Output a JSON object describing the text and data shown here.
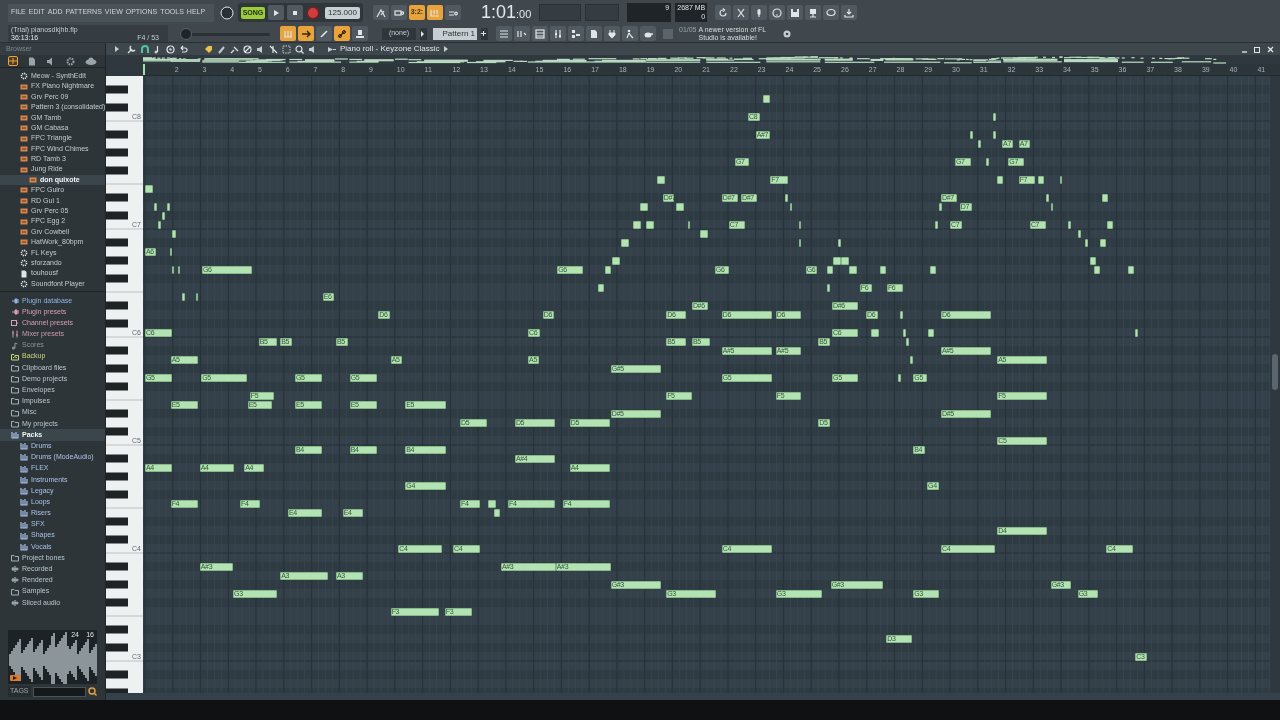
{
  "menu": [
    "FILE",
    "EDIT",
    "ADD",
    "PATTERNS",
    "VIEW",
    "OPTIONS",
    "TOOLS",
    "HELP"
  ],
  "hint_panel": {
    "title": "(Trial) pianosdkjhb.flp",
    "time": "36:13:16",
    "position": "F4 / 53"
  },
  "transport": {
    "mode": "SONG",
    "song_mode": true,
    "tempo": "125.000"
  },
  "toggles_top": [
    {
      "on": false
    },
    {
      "on": false
    },
    {
      "on": true,
      "label": "3:2:"
    },
    {
      "on": true
    },
    {
      "on": false
    }
  ],
  "toggles_bottom": [
    {
      "on": true
    },
    {
      "on": true
    },
    {
      "on": false
    },
    {
      "on": true
    },
    {
      "on": false
    }
  ],
  "pitch_slider": {
    "level": 0
  },
  "clock": {
    "main": "1:01",
    "ticks": ":00"
  },
  "monitor": {
    "cpu": "9",
    "memory": "2687 MB",
    "polyphony": "0"
  },
  "pattern": {
    "target": "(none)",
    "name": "Pattern 1"
  },
  "news": {
    "counter": "01/05",
    "text": "A newer version of FL Studio is available!"
  },
  "browser": {
    "title": "Browser",
    "channels": [
      {
        "label": "Meow - SynthEdit",
        "kind": "gear",
        "selected": false
      },
      {
        "label": "FX Piano Nightmare",
        "kind": "pattern",
        "selected": false
      },
      {
        "label": "Grv Perc 09",
        "kind": "pattern",
        "selected": false
      },
      {
        "label": "Pattern 3 (consolidated)",
        "kind": "pattern",
        "selected": false
      },
      {
        "label": "GM Tamb",
        "kind": "pattern",
        "selected": false
      },
      {
        "label": "GM Cabasa",
        "kind": "pattern",
        "selected": false
      },
      {
        "label": "FPC Triangle",
        "kind": "pattern",
        "selected": false
      },
      {
        "label": "FPC Wind Chimes",
        "kind": "pattern",
        "selected": false
      },
      {
        "label": "RD Tamb 3",
        "kind": "pattern",
        "selected": false
      },
      {
        "label": "Jung Ride",
        "kind": "pattern",
        "selected": false,
        "children": [
          {
            "label": "don quixote",
            "kind": "pattern",
            "selected": true
          }
        ]
      },
      {
        "label": "FPC Guiro",
        "kind": "pattern",
        "selected": false
      },
      {
        "label": "RD Gui 1",
        "kind": "pattern",
        "selected": false
      },
      {
        "label": "Grv Perc 05",
        "kind": "pattern",
        "selected": false
      },
      {
        "label": "FPC Egg 2",
        "kind": "pattern",
        "selected": false
      },
      {
        "label": "Grv Cowbell",
        "kind": "pattern",
        "selected": false
      },
      {
        "label": "HatWork_80bpm",
        "kind": "pattern",
        "selected": false
      },
      {
        "label": "FL Keys",
        "kind": "gear",
        "selected": false
      },
      {
        "label": "sforzando",
        "kind": "gear",
        "selected": false
      },
      {
        "label": "touhousf",
        "kind": "file",
        "selected": false
      },
      {
        "label": "Soundfont Player",
        "kind": "gear",
        "selected": false
      }
    ],
    "folders": [
      {
        "label": "Plugin database",
        "kind": "database",
        "selected": false
      },
      {
        "label": "Plugin presets",
        "kind": "preset",
        "selected": false
      },
      {
        "label": "Channel presets",
        "kind": "channel_preset",
        "selected": false
      },
      {
        "label": "Mixer presets",
        "kind": "mixer_preset",
        "selected": false
      },
      {
        "label": "Scores",
        "kind": "score",
        "selected": false
      },
      {
        "label": "Backup",
        "kind": "backup",
        "selected": false
      },
      {
        "label": "Clipboard files",
        "kind": "folder",
        "selected": false
      },
      {
        "label": "Demo projects",
        "kind": "folder",
        "selected": false
      },
      {
        "label": "Envelopes",
        "kind": "folder",
        "selected": false
      },
      {
        "label": "Impulses",
        "kind": "folder",
        "selected": false
      },
      {
        "label": "Misc",
        "kind": "folder",
        "selected": false
      },
      {
        "label": "My projects",
        "kind": "folder",
        "selected": false
      },
      {
        "label": "Packs",
        "kind": "pack",
        "selected": true,
        "children": [
          {
            "label": "Drums",
            "kind": "pack",
            "selected": false
          },
          {
            "label": "Drums (ModeAudio)",
            "kind": "pack",
            "selected": false
          },
          {
            "label": "FLEX",
            "kind": "pack",
            "selected": false
          },
          {
            "label": "Instruments",
            "kind": "pack",
            "selected": false
          },
          {
            "label": "Legacy",
            "kind": "pack",
            "selected": false
          },
          {
            "label": "Loops",
            "kind": "pack",
            "selected": false
          },
          {
            "label": "Risers",
            "kind": "pack",
            "selected": false
          },
          {
            "label": "SFX",
            "kind": "pack",
            "selected": false
          },
          {
            "label": "Shapes",
            "kind": "pack",
            "selected": false
          },
          {
            "label": "Vocals",
            "kind": "pack",
            "selected": false
          }
        ]
      },
      {
        "label": "Project bones",
        "kind": "folder",
        "selected": false
      },
      {
        "label": "Recorded",
        "kind": "recorded",
        "selected": false
      },
      {
        "label": "Rendered",
        "kind": "recorded",
        "selected": false
      },
      {
        "label": "Samples",
        "kind": "folder",
        "selected": false
      },
      {
        "label": "Sliced audio",
        "kind": "recorded",
        "selected": false
      }
    ],
    "preview": {
      "bits": "24",
      "channels": "16"
    },
    "tags_label": "TAGS"
  },
  "piano_roll": {
    "title": "Piano roll - Keyzone Classic",
    "bars": [
      "2",
      "3",
      "4",
      "5",
      "6",
      "7",
      "8",
      "9",
      "10",
      "11",
      "12",
      "13",
      "14",
      "15",
      "16",
      "17",
      "18",
      "19",
      "20",
      "21",
      "22",
      "23",
      "24",
      "25",
      "26",
      "27",
      "28",
      "29",
      "30",
      "31",
      "32",
      "33",
      "34",
      "35",
      "36",
      "37",
      "38",
      "39",
      "40",
      "41"
    ],
    "octaves": [
      "C8",
      "C7",
      "C6",
      "C5",
      "C4",
      "C3"
    ],
    "notes": [
      {
        "kind": "short"
      },
      {
        "kind": "short"
      },
      {
        "kind": "short"
      },
      {
        "kind": "short"
      },
      {
        "kind": "short"
      },
      {
        "kind": "short"
      },
      {
        "kind": "labeled",
        "label": "A6"
      },
      {
        "kind": "short"
      },
      {
        "kind": "short"
      },
      {
        "kind": "short"
      },
      {
        "kind": "labeled",
        "label": "G6"
      },
      {
        "kind": "short"
      },
      {
        "kind": "short"
      },
      {
        "kind": "labeled",
        "label": "E6"
      },
      {
        "kind": "labeled",
        "label": "D6"
      },
      {
        "kind": "labeled",
        "label": "C6"
      },
      {
        "kind": "labeled",
        "label": "B5"
      },
      {
        "kind": "labeled",
        "label": "B5"
      },
      {
        "kind": "labeled",
        "label": "B5"
      },
      {
        "kind": "labeled",
        "label": "A5"
      },
      {
        "kind": "labeled",
        "label": "A5"
      },
      {
        "kind": "labeled",
        "label": "G5"
      },
      {
        "kind": "labeled",
        "label": "G5"
      },
      {
        "kind": "labeled",
        "label": "G5"
      },
      {
        "kind": "labeled",
        "label": "G5"
      },
      {
        "kind": "labeled",
        "label": "F5"
      },
      {
        "kind": "labeled",
        "label": "E5"
      },
      {
        "kind": "labeled",
        "label": "E5"
      },
      {
        "kind": "labeled",
        "label": "E5"
      },
      {
        "kind": "labeled",
        "label": "E5"
      },
      {
        "kind": "labeled",
        "label": "E5"
      },
      {
        "kind": "labeled",
        "label": "B4"
      },
      {
        "kind": "labeled",
        "label": "B4"
      },
      {
        "kind": "labeled",
        "label": "B4"
      },
      {
        "kind": "labeled",
        "label": "A4"
      },
      {
        "kind": "labeled",
        "label": "A4"
      },
      {
        "kind": "labeled",
        "label": "A4"
      },
      {
        "kind": "labeled",
        "label": "D5"
      },
      {
        "kind": "labeled",
        "label": "D5"
      },
      {
        "kind": "labeled",
        "label": "D5"
      },
      {
        "kind": "labeled",
        "label": "G4"
      },
      {
        "kind": "labeled",
        "label": "F4"
      },
      {
        "kind": "labeled",
        "label": "F4"
      },
      {
        "kind": "labeled",
        "label": "F4"
      },
      {
        "kind": "short"
      },
      {
        "kind": "labeled",
        "label": "F4"
      },
      {
        "kind": "labeled",
        "label": "F4"
      },
      {
        "kind": "labeled",
        "label": "E4"
      },
      {
        "kind": "labeled",
        "label": "E4"
      },
      {
        "kind": "short"
      },
      {
        "kind": "labeled",
        "label": "C4"
      },
      {
        "kind": "labeled",
        "label": "C4"
      },
      {
        "kind": "labeled",
        "label": "A#3"
      },
      {
        "kind": "labeled",
        "label": "A3"
      },
      {
        "kind": "labeled",
        "label": "A3"
      },
      {
        "kind": "labeled",
        "label": "G3"
      },
      {
        "kind": "labeled",
        "label": "F3"
      },
      {
        "kind": "labeled",
        "label": "F3"
      },
      {
        "kind": "labeled",
        "label": "A#3"
      },
      {
        "kind": "labeled",
        "label": "A#3"
      },
      {
        "kind": "labeled",
        "label": "A#4"
      },
      {
        "kind": "labeled",
        "label": "A4"
      },
      {
        "kind": "labeled",
        "label": "C6"
      },
      {
        "kind": "labeled",
        "label": "A5"
      },
      {
        "kind": "labeled",
        "label": "D6"
      },
      {
        "kind": "labeled",
        "label": "G6"
      },
      {
        "kind": "short"
      },
      {
        "kind": "short"
      },
      {
        "kind": "short"
      },
      {
        "kind": "short"
      },
      {
        "kind": "short"
      },
      {
        "kind": "short"
      },
      {
        "kind": "short"
      },
      {
        "kind": "short"
      },
      {
        "kind": "labeled",
        "label": "D#7"
      },
      {
        "kind": "short"
      },
      {
        "kind": "short"
      },
      {
        "kind": "short"
      },
      {
        "kind": "labeled",
        "label": "G#5"
      },
      {
        "kind": "labeled",
        "label": "D#5"
      },
      {
        "kind": "labeled",
        "label": "G#3"
      },
      {
        "kind": "labeled",
        "label": "D6"
      },
      {
        "kind": "labeled",
        "label": "B5"
      },
      {
        "kind": "labeled",
        "label": "F5"
      },
      {
        "kind": "labeled",
        "label": "D#6"
      },
      {
        "kind": "labeled",
        "label": "G3"
      },
      {
        "kind": "labeled",
        "label": "B5"
      },
      {
        "kind": "labeled",
        "label": "G6"
      },
      {
        "kind": "labeled",
        "label": "D#7"
      },
      {
        "kind": "labeled",
        "label": "D6"
      },
      {
        "kind": "labeled",
        "label": "D6"
      },
      {
        "kind": "labeled",
        "label": "A#5"
      },
      {
        "kind": "labeled",
        "label": "A#5"
      },
      {
        "kind": "labeled",
        "label": "F5"
      },
      {
        "kind": "labeled",
        "label": "G5"
      },
      {
        "kind": "labeled",
        "label": "G3"
      },
      {
        "kind": "labeled",
        "label": "G#3"
      },
      {
        "kind": "labeled",
        "label": "C4"
      },
      {
        "kind": "labeled",
        "label": "D#7"
      },
      {
        "kind": "labeled",
        "label": "C7"
      },
      {
        "kind": "labeled",
        "label": "G7"
      },
      {
        "kind": "labeled",
        "label": "C8"
      },
      {
        "kind": "labeled",
        "label": "A#7"
      },
      {
        "kind": "short"
      },
      {
        "kind": "labeled",
        "label": "F7"
      },
      {
        "kind": "short"
      },
      {
        "kind": "short"
      },
      {
        "kind": "short"
      },
      {
        "kind": "short"
      },
      {
        "kind": "labeled",
        "label": "G6"
      },
      {
        "kind": "labeled",
        "label": "B5"
      },
      {
        "kind": "labeled",
        "label": "D5"
      },
      {
        "kind": "short"
      },
      {
        "kind": "short"
      },
      {
        "kind": "short"
      },
      {
        "kind": "short"
      },
      {
        "kind": "short"
      },
      {
        "kind": "labeled",
        "label": "D#6"
      },
      {
        "kind": "labeled",
        "label": "C6"
      },
      {
        "kind": "labeled",
        "label": "G5"
      },
      {
        "kind": "short"
      },
      {
        "kind": "labeled",
        "label": "F6"
      },
      {
        "kind": "labeled",
        "label": "D6"
      },
      {
        "kind": "short"
      },
      {
        "kind": "short"
      },
      {
        "kind": "labeled",
        "label": "F6"
      },
      {
        "kind": "short"
      },
      {
        "kind": "short"
      },
      {
        "kind": "short"
      },
      {
        "kind": "short"
      },
      {
        "kind": "short"
      },
      {
        "kind": "labeled",
        "label": "G5"
      },
      {
        "kind": "labeled",
        "label": "B4"
      },
      {
        "kind": "labeled",
        "label": "G4"
      },
      {
        "kind": "labeled",
        "label": "G3"
      },
      {
        "kind": "labeled",
        "label": "D3"
      },
      {
        "kind": "short"
      },
      {
        "kind": "short"
      },
      {
        "kind": "labeled",
        "label": "D#7"
      },
      {
        "kind": "labeled",
        "label": "D6"
      },
      {
        "kind": "labeled",
        "label": "A#5"
      },
      {
        "kind": "labeled",
        "label": "D#5"
      },
      {
        "kind": "short"
      },
      {
        "kind": "short"
      },
      {
        "kind": "labeled",
        "label": "C4"
      },
      {
        "kind": "labeled",
        "label": "D7"
      },
      {
        "kind": "labeled",
        "label": "C7"
      },
      {
        "kind": "labeled",
        "label": "G7"
      },
      {
        "kind": "short"
      },
      {
        "kind": "short"
      },
      {
        "kind": "short"
      },
      {
        "kind": "short"
      },
      {
        "kind": "short"
      },
      {
        "kind": "labeled",
        "label": "A7"
      },
      {
        "kind": "labeled",
        "label": "A7"
      },
      {
        "kind": "labeled",
        "label": "G7"
      },
      {
        "kind": "short"
      },
      {
        "kind": "labeled",
        "label": "F7"
      },
      {
        "kind": "short"
      },
      {
        "kind": "labeled",
        "label": "C7"
      },
      {
        "kind": "short"
      },
      {
        "kind": "short"
      },
      {
        "kind": "short"
      },
      {
        "kind": "short"
      },
      {
        "kind": "short"
      },
      {
        "kind": "short"
      },
      {
        "kind": "short"
      },
      {
        "kind": "short"
      },
      {
        "kind": "short"
      },
      {
        "kind": "short"
      },
      {
        "kind": "short"
      },
      {
        "kind": "short"
      },
      {
        "kind": "labeled",
        "label": "A5"
      },
      {
        "kind": "labeled",
        "label": "F5"
      },
      {
        "kind": "labeled",
        "label": "C5"
      },
      {
        "kind": "labeled",
        "label": "D4"
      },
      {
        "kind": "labeled",
        "label": "G#3"
      },
      {
        "kind": "labeled",
        "label": "G3"
      },
      {
        "kind": "labeled",
        "label": "C4"
      },
      {
        "kind": "short"
      },
      {
        "kind": "labeled",
        "label": "C3"
      }
    ]
  }
}
